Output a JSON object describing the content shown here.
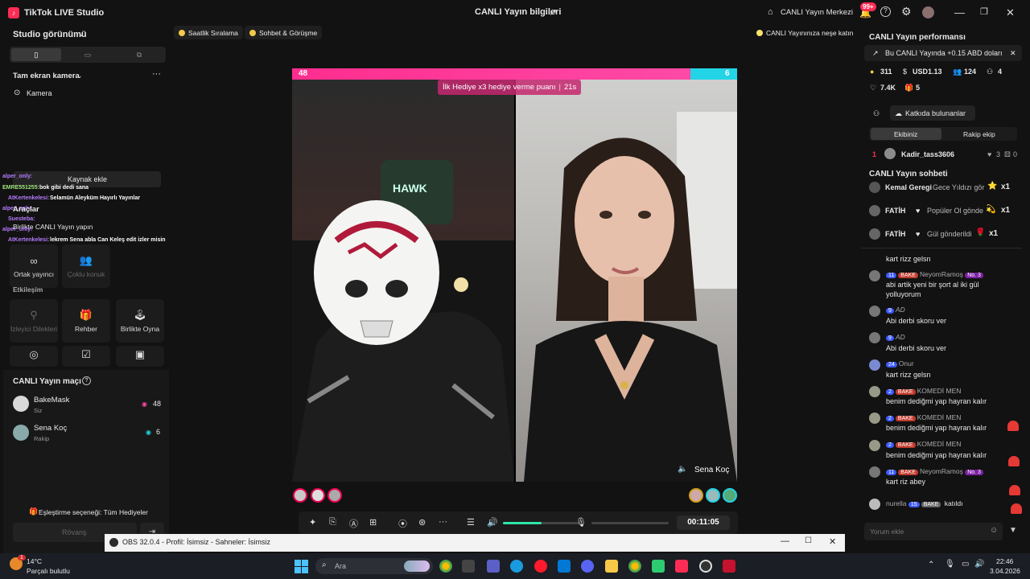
{
  "titlebar": {
    "app_name": "TikTok LIVE Studio",
    "center_title": "CANLI Yayın bilgileri",
    "live_center": "CANLI Yayın Merkezi",
    "notif_badge": "99+"
  },
  "left": {
    "studio_view": "Studio görünümü",
    "fullscreen_camera": "Tam ekran kamera",
    "camera": "Kamera",
    "add_source": "Kaynak ekle",
    "tools": "Araçlar",
    "play_together_live": "Birlikte CANLI Yayın yapın",
    "co_host": "Ortak yayıncı",
    "multi_guest": "Çoklu konuk",
    "interaction": "Etkileşim",
    "viewer_wishes": "İzleyici Dilekleri",
    "guide": "Rehber",
    "play_together": "Birlikte Oyna",
    "match_title": "CANLI Yayın maçı",
    "players": [
      {
        "name": "BakeMask",
        "role": "Siz",
        "score": "48"
      },
      {
        "name": "Sena Koç",
        "role": "Rakip",
        "score": "6"
      }
    ],
    "match_option": "Eşleştirme seçeneği: Tüm Hediyeler",
    "rematch": "Rövanş",
    "overlay_chat": [
      {
        "user": "alper_only:",
        "msg": ""
      },
      {
        "user": "EMRE551255:",
        "msg": "bok gibi dedi sana"
      },
      {
        "user": "AtKertenkelesi:",
        "msg": "Selamün Aleyküm Hayırlı Yayınlar"
      },
      {
        "user": "alper_only:",
        "msg": ""
      },
      {
        "user": "Suesteba:",
        "msg": ""
      },
      {
        "user": "alper_only:",
        "msg": ""
      },
      {
        "user": "AtKertenkelesi:",
        "msg": "lekrem Sena abla Can Keleş edit izler misin"
      }
    ]
  },
  "center": {
    "pill_hourly": "Saatlik Sıralama",
    "pill_chat": "Sohbet & Görüşme",
    "pill_joy": "CANLI Yayınınıza neşe katın",
    "pk_left_score": "48",
    "pk_right_score": "6",
    "gift_banner": "İlk Hediye x3 hediye verme puanı",
    "gift_timer": "21s",
    "opponent_name": "Sena Koç",
    "timer": "00:11:05",
    "volume_pct": 50
  },
  "right": {
    "perf_title": "CANLI Yayın performansı",
    "perf_banner": "Bu CANLI Yayında +0.15 ABD doları",
    "stats": {
      "coins": "311",
      "usd": "USD1.13",
      "viewers": "124",
      "new_followers": "4",
      "likes": "7.4K",
      "gifters": "5"
    },
    "contributors_btn": "Katkıda bulunanlar",
    "tab_ours": "Ekibiniz",
    "tab_rival": "Rakip ekip",
    "top_rank": "1",
    "top_user": "Kadir_tass3606",
    "top_hearts": "3",
    "top_gifts": "0",
    "chat_title": "CANLI Yayın sohbeti",
    "gift_rows": [
      {
        "user": "Kemal Geregi",
        "gift": "Gece Yıldızı gör",
        "count": "x1"
      },
      {
        "user": "FATİH",
        "gift": "Popüler Ol gönde",
        "count": "x1"
      },
      {
        "user": "FATİH",
        "gift": "Gül gönderildi",
        "count": "x1"
      }
    ],
    "chat": [
      {
        "level": "",
        "fan": "",
        "user": "",
        "msg": "kart rizz gelsn"
      },
      {
        "level": "11",
        "fan": "BAKE",
        "user": "NeyomRamoş",
        "rank": "No. 3",
        "msg": "abi artik yeni bir şort al iki gül yolluyorum"
      },
      {
        "level": "9",
        "fan": "",
        "user": "AD",
        "msg": "Abi derbi skoru ver"
      },
      {
        "level": "9",
        "fan": "",
        "user": "AD",
        "msg": "Abi derbi skoru ver"
      },
      {
        "level": "24",
        "fan": "",
        "user": "Onur",
        "msg": "kart rizz gelsn"
      },
      {
        "level": "2",
        "fan": "BAKE",
        "user": "KOMEDİ MEN",
        "msg": "benim dediğmi yap hayran kalır"
      },
      {
        "level": "2",
        "fan": "BAKE",
        "user": "KOMEDİ MEN",
        "msg": "benim dediğmi yap hayran kalır"
      },
      {
        "level": "2",
        "fan": "BAKE",
        "user": "KOMEDİ MEN",
        "msg": "benim dediğmi yap hayran kalır"
      },
      {
        "level": "11",
        "fan": "BAKE",
        "user": "NeyomRamoş",
        "rank": "No. 3",
        "msg": "kart riz abey"
      }
    ],
    "join_user": "nurella",
    "join_level": "15",
    "join_fan": "BAKE",
    "join_text": "katıldı",
    "comment_placeholder": "Yorum ekle"
  },
  "obs": {
    "title": "OBS 32.0.4 - Profil: İsimsiz - Sahneler: İsimsiz"
  },
  "taskbar": {
    "weather_temp": "14°C",
    "weather_desc": "Parçalı bulutlu",
    "search_placeholder": "Ara",
    "time": "22:46",
    "date": "3.04.2026"
  },
  "colors": {
    "accent_pink": "#fe2c55",
    "pk_left": "#ff2d8e",
    "pk_right": "#23d4e6"
  }
}
